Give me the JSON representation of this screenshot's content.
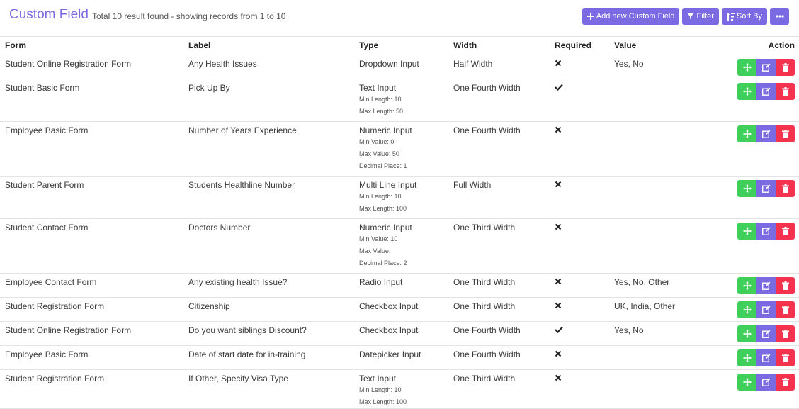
{
  "header": {
    "title": "Custom Field",
    "summary": "Total 10 result found - showing records from 1 to 10",
    "buttons": {
      "add": "Add new Custom Field",
      "filter": "Filter",
      "sort": "Sort By"
    }
  },
  "table": {
    "columns": {
      "form": "Form",
      "label": "Label",
      "type": "Type",
      "width": "Width",
      "required": "Required",
      "value": "Value",
      "action": "Action"
    },
    "rows": [
      {
        "form": "Student Online Registration Form",
        "label": "Any Health Issues",
        "type": "Dropdown Input",
        "details": [],
        "width": "Half Width",
        "required": false,
        "value": "Yes, No"
      },
      {
        "form": "Student Basic Form",
        "label": "Pick Up By",
        "type": "Text Input",
        "details": [
          "Min Length: 10",
          "Max Length: 50"
        ],
        "width": "One Fourth Width",
        "required": true,
        "value": ""
      },
      {
        "form": "Employee Basic Form",
        "label": "Number of Years Experience",
        "type": "Numeric Input",
        "details": [
          "Min Value: 0",
          "Max Value: 50",
          "Decimal Place: 1"
        ],
        "width": "One Fourth Width",
        "required": false,
        "value": ""
      },
      {
        "form": "Student Parent Form",
        "label": "Students Healthline Number",
        "type": "Multi Line Input",
        "details": [
          "Min Length: 10",
          "Max Length: 100"
        ],
        "width": "Full Width",
        "required": false,
        "value": ""
      },
      {
        "form": "Student Contact Form",
        "label": "Doctors Number",
        "type": "Numeric Input",
        "details": [
          "Min Value: 10",
          "Max Value:",
          "Decimal Place: 2"
        ],
        "width": "One Third Width",
        "required": false,
        "value": ""
      },
      {
        "form": "Employee Contact Form",
        "label": "Any existing health Issue?",
        "type": "Radio Input",
        "details": [],
        "width": "One Third Width",
        "required": false,
        "value": "Yes, No, Other"
      },
      {
        "form": "Student Registration Form",
        "label": "Citizenship",
        "type": "Checkbox Input",
        "details": [],
        "width": "One Third Width",
        "required": false,
        "value": "UK, India, Other"
      },
      {
        "form": "Student Online Registration Form",
        "label": "Do you want siblings Discount?",
        "type": "Checkbox Input",
        "details": [],
        "width": "One Fourth Width",
        "required": true,
        "value": "Yes, No"
      },
      {
        "form": "Employee Basic Form",
        "label": "Date of start date for in-training",
        "type": "Datepicker Input",
        "details": [],
        "width": "One Fourth Width",
        "required": false,
        "value": ""
      },
      {
        "form": "Student Registration Form",
        "label": "If Other, Specify Visa Type",
        "type": "Text Input",
        "details": [
          "Min Length: 10",
          "Max Length: 100"
        ],
        "width": "One Third Width",
        "required": false,
        "value": ""
      }
    ]
  },
  "icons": {
    "required_yes": "check-icon",
    "required_no": "cross-icon",
    "move": "move-icon",
    "edit": "edit-icon",
    "delete": "trash-icon"
  },
  "colors": {
    "accent": "#7b6be2",
    "move": "#3fcf5a",
    "delete": "#f5334f"
  }
}
